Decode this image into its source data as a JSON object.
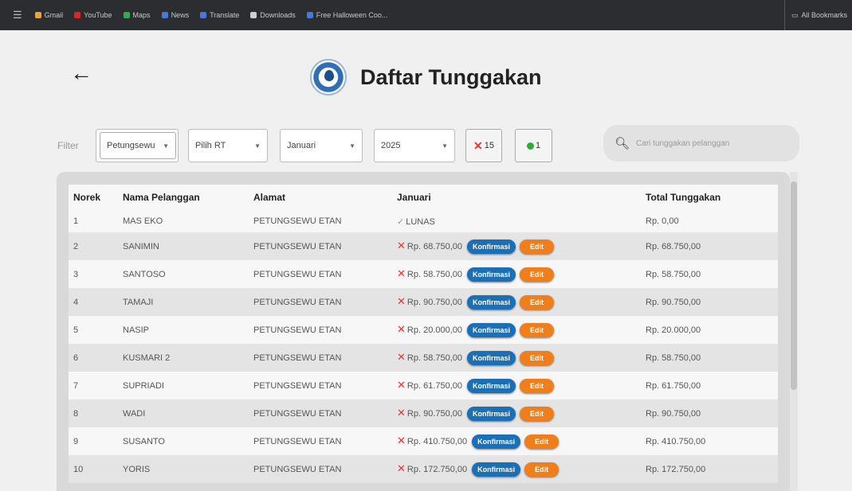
{
  "bookmarks": {
    "items": [
      {
        "label": "Gmail",
        "icon": "gmail-icon",
        "color": "#e8a33a"
      },
      {
        "label": "YouTube",
        "icon": "youtube-icon",
        "color": "#e02424"
      },
      {
        "label": "Maps",
        "icon": "maps-icon",
        "color": "#34a853"
      },
      {
        "label": "News",
        "icon": "news-icon",
        "color": "#4a78d8"
      },
      {
        "label": "Translate",
        "icon": "translate-icon",
        "color": "#4a78d8"
      },
      {
        "label": "Downloads",
        "icon": "download-icon",
        "color": "#cfcfcf"
      },
      {
        "label": "Free Halloween Coo...",
        "icon": "bookmark-icon",
        "color": "#4a78d8"
      }
    ],
    "all_bookmarks": "All Bookmarks"
  },
  "header": {
    "title": "Daftar Tunggakan"
  },
  "filter": {
    "label": "Filter",
    "dusun": "Petungsewu",
    "rt": "Pilih RT",
    "month": "Januari",
    "year": "2025",
    "unpaid_count": "15",
    "paid_count": "1"
  },
  "search": {
    "placeholder": "Cari tunggakan pelanggan"
  },
  "table": {
    "columns": [
      "Norek",
      "Nama Pelanggan",
      "Alamat",
      "Januari",
      "Total Tunggakan"
    ],
    "confirm_label": "Konfirmasi",
    "edit_label": "Edit",
    "rows": [
      {
        "norek": "1",
        "name": "MAS EKO",
        "address": "PETUNGSEWU ETAN",
        "status": "paid",
        "amount": "LUNAS",
        "total": "Rp. 0,00"
      },
      {
        "norek": "2",
        "name": "SANIMIN",
        "address": "PETUNGSEWU ETAN",
        "status": "unpaid",
        "amount": "Rp. 68.750,00",
        "total": "Rp. 68.750,00"
      },
      {
        "norek": "3",
        "name": "SANTOSO",
        "address": "PETUNGSEWU ETAN",
        "status": "unpaid",
        "amount": "Rp. 58.750,00",
        "total": "Rp. 58.750,00"
      },
      {
        "norek": "4",
        "name": "TAMAJI",
        "address": "PETUNGSEWU ETAN",
        "status": "unpaid",
        "amount": "Rp. 90.750,00",
        "total": "Rp. 90.750,00"
      },
      {
        "norek": "5",
        "name": "NASIP",
        "address": "PETUNGSEWU ETAN",
        "status": "unpaid",
        "amount": "Rp. 20.000,00",
        "total": "Rp. 20.000,00"
      },
      {
        "norek": "6",
        "name": "KUSMARI 2",
        "address": "PETUNGSEWU ETAN",
        "status": "unpaid",
        "amount": "Rp. 58.750,00",
        "total": "Rp. 58.750,00"
      },
      {
        "norek": "7",
        "name": "SUPRIADI",
        "address": "PETUNGSEWU ETAN",
        "status": "unpaid",
        "amount": "Rp. 61.750,00",
        "total": "Rp. 61.750,00"
      },
      {
        "norek": "8",
        "name": "WADI",
        "address": "PETUNGSEWU ETAN",
        "status": "unpaid",
        "amount": "Rp. 90.750,00",
        "total": "Rp. 90.750,00"
      },
      {
        "norek": "9",
        "name": "SUSANTO",
        "address": "PETUNGSEWU ETAN",
        "status": "unpaid",
        "amount": "Rp. 410.750,00",
        "total": "Rp. 410.750,00"
      },
      {
        "norek": "10",
        "name": "YORIS",
        "address": "PETUNGSEWU ETAN",
        "status": "unpaid",
        "amount": "Rp. 172.750,00",
        "total": "Rp. 172.750,00"
      }
    ]
  },
  "colors": {
    "confirm_button": "#1a6fb6",
    "edit_button": "#f07e1a",
    "unpaid_mark": "#e33333",
    "paid_mark": "#33aa33"
  }
}
